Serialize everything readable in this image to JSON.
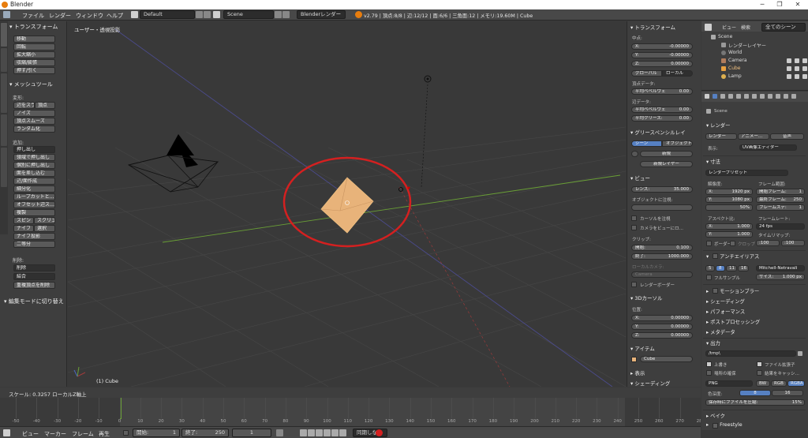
{
  "window": {
    "title": "Blender",
    "controls": [
      "─",
      "❐",
      "✕"
    ]
  },
  "menubar": {
    "items": [
      "ファイル",
      "レンダー",
      "ウィンドウ",
      "ヘルプ"
    ],
    "layout": "Default",
    "scene": "Scene",
    "engine": "Blenderレンダー",
    "stats": "v2.79 | 頂点:8/8 | 辺:12/12 | 面:6/6 | 三角面:12 | メモリ:19.60M | Cube"
  },
  "toolshelf": {
    "tabs": [
      "ツール",
      "作成",
      "シェーディング/UV",
      "オプション",
      "グリースペンシル"
    ],
    "transform_header": "トランスフォーム",
    "transform_buttons": [
      "移動",
      "回転",
      "拡大縮小",
      "収縮/膨張",
      "押す/引く"
    ],
    "meshtools_header": "メッシュツール",
    "deform_label": "変形:",
    "deform_buttons": [
      "辺をスライド",
      "頂点",
      "ノイズ",
      "頂点スムーズ",
      "ランダム化"
    ],
    "add_label": "追加:",
    "add_buttons": [
      "押し出し",
      "領域で押し出し",
      "個別に押し出し",
      "面を差し込む",
      "辺/面作成",
      "細分化",
      "ループカットと…",
      "オフセット辺ス…",
      "複製",
      "スピン",
      "スクリュー",
      "ナイフ",
      "選択",
      "ナイフ投影",
      "二等分"
    ],
    "delete_label": "削除:",
    "delete_buttons": [
      "削除",
      "結合",
      "重複頂点を削除"
    ],
    "bottom_panel": "編集モードに切り替え"
  },
  "viewport": {
    "label": "ユーザー・透視投影",
    "object_label": "(1) Cube"
  },
  "npanel": {
    "transform_header": "トランスフォーム",
    "median_label": "中点:",
    "median": [
      {
        "axis": "X:",
        "value": "-0.00000"
      },
      {
        "axis": "Y:",
        "value": "-0.00000"
      },
      {
        "axis": "Z:",
        "value": "0.00000"
      }
    ],
    "global_label": "グローバル",
    "local_label": "ローカル",
    "vertex_data_label": "頂点データ:",
    "vertex_bevel": "平均ベベルウェ",
    "vertex_bevel_value": "0.00",
    "edge_data_label": "辺データ:",
    "edge_bevel": "平均ベベルウェ",
    "edge_bevel_value": "0.00",
    "edge_crease": "平均クリース:",
    "edge_crease_value": "0.00",
    "grease_header": "グリースペンシルレイ",
    "scene_btn": "シーン",
    "object_btn": "オブジェクト",
    "new_btn": "新規",
    "new_layer_btn": "新規レイヤー",
    "view_header": "ビュー",
    "lens_label": "レンズ:",
    "lens_value": "35.000",
    "lock_object_label": "オブジェクトに注視:",
    "lock_cursor": "カーソルを注視",
    "lock_camera": "カメラをビューにロ…",
    "clip_label": "クリップ:",
    "clip_start": "開始:",
    "clip_start_value": "0.100",
    "clip_end": "終了:",
    "clip_end_value": "1000.000",
    "local_camera_label": "ローカルカメラ:",
    "local_camera_value": "Camera",
    "render_border": "レンダーボーダー",
    "cursor_header": "3Dカーソル",
    "location_label": "位置:",
    "cursor": [
      {
        "axis": "X:",
        "value": "0.00000"
      },
      {
        "axis": "Y:",
        "value": "0.00000"
      },
      {
        "axis": "Z:",
        "value": "0.00000"
      }
    ],
    "item_header": "アイテム",
    "item_name": "Cube",
    "display_header": "表示",
    "shading_header": "シェーディング"
  },
  "outliner": {
    "view_menu": "ビュー",
    "search_menu": "検索",
    "filter": "全てのシーン",
    "items": [
      "Scene",
      "レンダーレイヤー",
      "World",
      "Camera",
      "Cube",
      "Lamp"
    ]
  },
  "properties": {
    "scene": "Scene",
    "render_header": "レンダー",
    "render_btn": "レンダー",
    "anim_btn": "アニメー…",
    "audio_btn": "音声",
    "display_label": "表示:",
    "display_value": "UV画像エディター",
    "dimensions_header": "寸法",
    "preset": "レンダープリセット",
    "resolution_label": "解像度:",
    "frame_range_label": "フレーム範囲:",
    "res_x": "X:",
    "res_x_value": "1920 px",
    "res_y": "Y:",
    "res_y_value": "1080 px",
    "res_pct": "50%",
    "start_frame": "開始フレーム:",
    "start_frame_value": "1",
    "end_frame": "最終フレーム:",
    "end_frame_value": "250",
    "frame_step": "フレームステ:",
    "frame_step_value": "1",
    "aspect_label": "アスペクト比:",
    "framerate_label": "フレームレート:",
    "aspect_x": "X:",
    "aspect_x_value": "1.000",
    "aspect_y": "Y:",
    "aspect_y_value": "1.000",
    "fps": "24 fps",
    "time_remap": "タイムリマップ:",
    "border": "ボーダー",
    "crop": "クロップ",
    "remap_old": ":100",
    "remap_new": ":100",
    "aa_header": "アンチエイリアス",
    "aa_samples": [
      "5",
      "8",
      "11",
      "16"
    ],
    "aa_filter": "Mitchell-Netravali",
    "full_sample": "フルサンプル",
    "filter_size": "サイズ:",
    "filter_size_value": "1.000 px",
    "collapsed": [
      "モーションブラー",
      "シェーディング",
      "パフォーマンス",
      "ポストプロセッシング",
      "メタデータ"
    ],
    "output_header": "出力",
    "output_path": "/tmp\\",
    "overwrite": "上書き",
    "file_extensions": "ファイル拡張子",
    "placeholders": "場所の確保",
    "cache_result": "結果をキャッシ…",
    "format": "PNG",
    "color_bw": "BW",
    "color_rgb": "RGB",
    "color_rgba": "RGBA",
    "color_depth_label": "色深度:",
    "depth_8": "8",
    "depth_16": "16",
    "compression": "保存時にファイルを圧縮:",
    "compression_value": "15%",
    "bake_header": "ベイク",
    "freestyle": "Freestyle"
  },
  "status": {
    "text": "スケール: 0.3257 ローカルZ軸上"
  },
  "timeline": {
    "ticks": [
      "-50",
      "-40",
      "-30",
      "-20",
      "-10",
      "0",
      "10",
      "20",
      "30",
      "40",
      "50",
      "60",
      "70",
      "80",
      "90",
      "100",
      "110",
      "120",
      "130",
      "140",
      "150",
      "160",
      "170",
      "180",
      "190",
      "200",
      "210",
      "220",
      "230",
      "240",
      "250",
      "260",
      "270",
      "280"
    ],
    "menus": [
      "ビュー",
      "マーカー",
      "フレーム",
      "再生"
    ],
    "start_label": "開始:",
    "start_value": "1",
    "end_label": "終了:",
    "end_value": "250",
    "current_frame": "1",
    "sync": "同期しない"
  },
  "colors": {
    "selection_circle": "#d42020",
    "cube": "#e8b37a",
    "x_axis": "#a03a3a",
    "y_axis": "#6aa036",
    "accent": "#5680c2"
  }
}
